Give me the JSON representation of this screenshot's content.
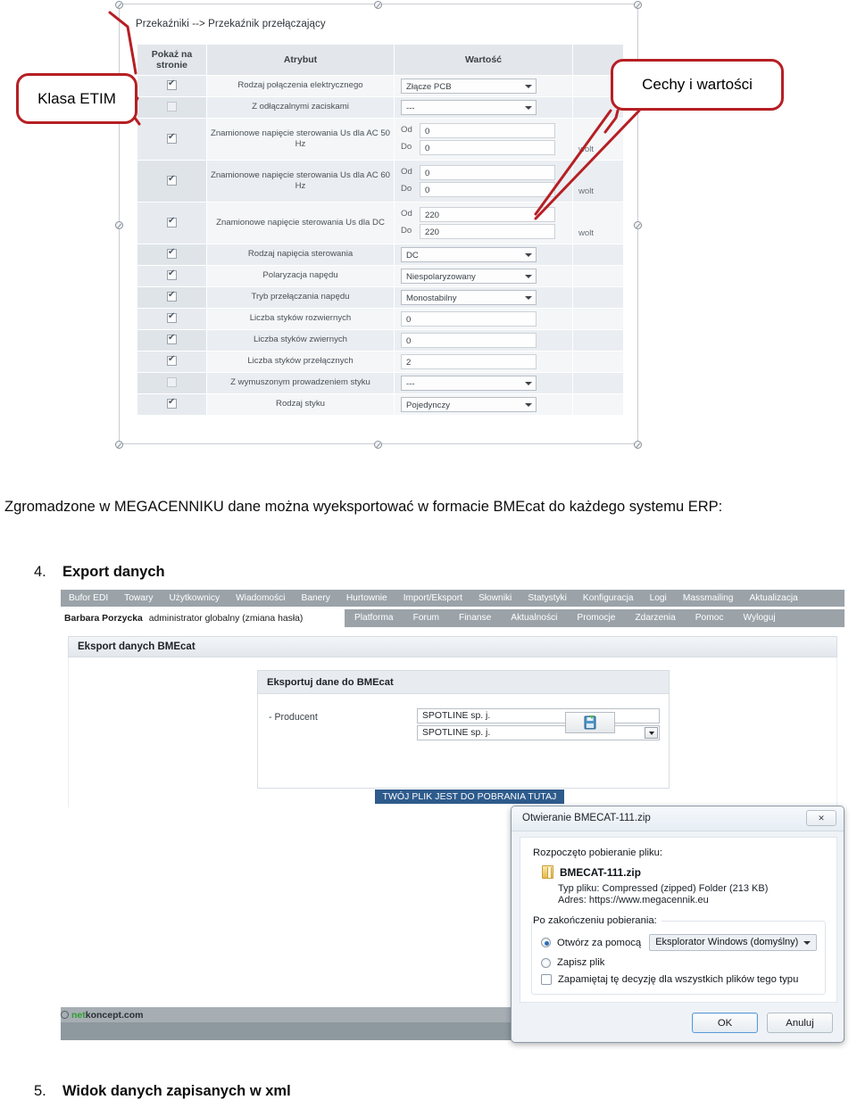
{
  "etim_figure": {
    "breadcrumb": "Przekaźniki --> Przekaźnik przełączający",
    "table": {
      "headers": [
        "Pokaż na stronie",
        "Atrybut",
        "Wartość",
        ""
      ],
      "rows": [
        {
          "checked": true,
          "attribute": "Rodzaj połączenia elektrycznego",
          "control": "select",
          "value": "Złącze PCB",
          "unit": ""
        },
        {
          "checked": false,
          "attribute": "Z odłączalnymi zaciskami",
          "control": "select",
          "value": "---",
          "unit": ""
        },
        {
          "checked": true,
          "attribute": "Znamionowe napięcie sterowania Us dla AC 50 Hz",
          "control": "range",
          "from_label": "Od",
          "from": "0",
          "to_label": "Do",
          "to": "0",
          "unit": "wolt"
        },
        {
          "checked": true,
          "attribute": "Znamionowe napięcie sterowania Us dla AC 60 Hz",
          "control": "range",
          "from_label": "Od",
          "from": "0",
          "to_label": "Do",
          "to": "0",
          "unit": "wolt"
        },
        {
          "checked": true,
          "attribute": "Znamionowe napięcie sterowania Us dla DC",
          "control": "range",
          "from_label": "Od",
          "from": "220",
          "to_label": "Do",
          "to": "220",
          "unit": "wolt"
        },
        {
          "checked": true,
          "attribute": "Rodzaj napięcia sterowania",
          "control": "select",
          "value": "DC",
          "unit": ""
        },
        {
          "checked": true,
          "attribute": "Polaryzacja napędu",
          "control": "select",
          "value": "Niespolaryzowany",
          "unit": ""
        },
        {
          "checked": true,
          "attribute": "Tryb przełączania napędu",
          "control": "select",
          "value": "Monostabilny",
          "unit": ""
        },
        {
          "checked": true,
          "attribute": "Liczba styków rozwiernych",
          "control": "text",
          "value": "0",
          "unit": ""
        },
        {
          "checked": true,
          "attribute": "Liczba styków zwiernych",
          "control": "text",
          "value": "0",
          "unit": ""
        },
        {
          "checked": true,
          "attribute": "Liczba styków przełącznych",
          "control": "text",
          "value": "2",
          "unit": ""
        },
        {
          "checked": false,
          "attribute": "Z wymuszonym prowadzeniem styku",
          "control": "select",
          "value": "---",
          "unit": ""
        },
        {
          "checked": true,
          "attribute": "Rodzaj styku",
          "control": "select",
          "value": "Pojedynczy",
          "unit": ""
        }
      ]
    }
  },
  "callouts": {
    "left": "Klasa ETIM",
    "right": "Cechy i wartości",
    "color": "#b61f24"
  },
  "document": {
    "paragraph": "Zgromadzone w MEGACENNIKU dane można wyeksportować w formacie BMEcat do każdego systemu ERP:",
    "item4_number": "4.",
    "item4_text": "Export danych",
    "item5_number": "5.",
    "item5_text": "Widok danych zapisanych w xml"
  },
  "app": {
    "top_nav": [
      "Bufor EDI",
      "Towary",
      "Użytkownicy",
      "Wiadomości",
      "Banery",
      "Hurtownie",
      "Import/Eksport",
      "Słowniki",
      "Statystyki",
      "Konfiguracja",
      "Logi",
      "Massmailing",
      "Aktualizacja"
    ],
    "user_line_name": "Barbara Porzycka",
    "user_line_rest": "administrator globalny (zmiana hasła)",
    "second_nav": [
      "Platforma",
      "Forum",
      "Finanse",
      "Aktualności",
      "Promocje",
      "Zdarzenia",
      "Pomoc",
      "Wyloguj"
    ],
    "panel_title": "Eksport danych BMEcat",
    "form": {
      "title": "Eksportuj dane do BMEcat",
      "label": "- Producent",
      "field_value": "SPOTLINE sp. j.",
      "select_value": "SPOTLINE sp. j.",
      "export_icon": "save-export-icon"
    },
    "download_banner": "TWÓJ PLIK JEST DO POBRANIA TUTAJ",
    "footer_logo_green": "net",
    "footer_logo_dark": "koncept.com"
  },
  "dialog": {
    "title": "Otwieranie BMECAT-111.zip",
    "close_label": "✕",
    "heading": "Rozpoczęto pobieranie pliku:",
    "file_name": "BMECAT-111.zip",
    "type_label": "Typ pliku:",
    "type_value": "Compressed (zipped) Folder (213 KB)",
    "address_label": "Adres:",
    "address_value": "https://www.megacennik.eu",
    "after_label": "Po zakończeniu pobierania:",
    "radio_open_label": "Otwórz za pomocą",
    "radio_open_selected": true,
    "combo_value": "Eksplorator Windows (domyślny)",
    "radio_save_label": "Zapisz plik",
    "checkbox_label": "Zapamiętaj tę decyzję dla wszystkich plików tego typu",
    "checkbox_checked": false,
    "ok_label": "OK",
    "cancel_label": "Anuluj"
  }
}
